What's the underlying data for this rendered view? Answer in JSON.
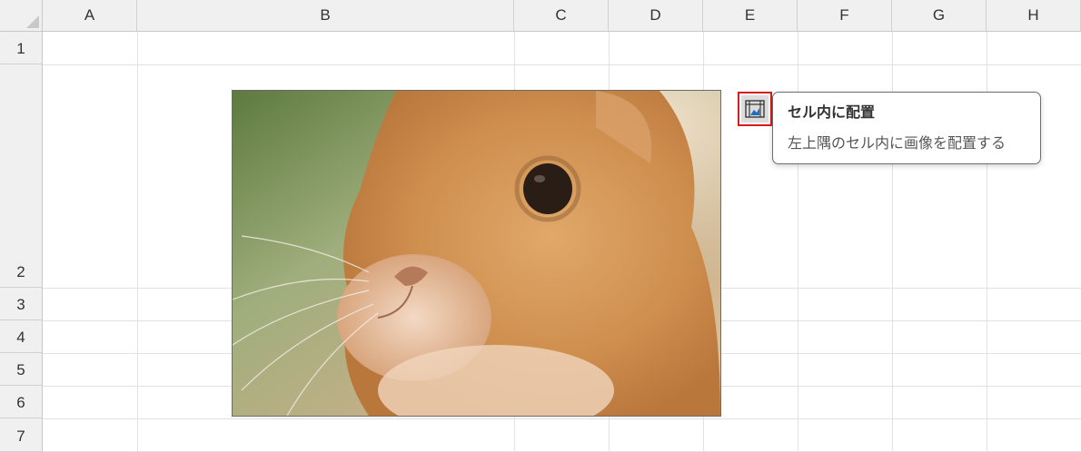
{
  "columns": [
    "A",
    "B",
    "C",
    "D",
    "E",
    "F",
    "G",
    "H"
  ],
  "rows": [
    "1",
    "2",
    "3",
    "4",
    "5",
    "6",
    "7"
  ],
  "image": {
    "description_icon": "rabbit-photo"
  },
  "place_in_cell_button": {
    "icon": "picture-in-cell-icon"
  },
  "tooltip": {
    "title": "セル内に配置",
    "description": "左上隅のセル内に画像を配置する"
  },
  "colors": {
    "highlight": "#d81b1b",
    "header_bg": "#f0f0f0",
    "gridline": "#e1e1e1"
  }
}
